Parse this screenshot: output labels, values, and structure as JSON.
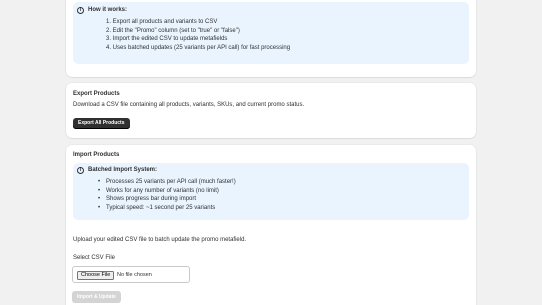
{
  "how_it_works": {
    "title": "How it works:",
    "steps": [
      "1. Export all products and variants to CSV",
      "2. Edit the \"Promo\" column (set to \"true\" or \"false\")",
      "3. Import the edited CSV to update metafields",
      "4. Uses batched updates (25 variants per API call) for fast processing"
    ]
  },
  "export": {
    "heading": "Export Products",
    "description": "Download a CSV file containing all products, variants, SKUs, and current promo status.",
    "button_label": "Export All Products"
  },
  "import": {
    "heading": "Import Products",
    "banner_title": "Batched Import System:",
    "features": [
      "Processes 25 variants per API call (much faster!)",
      "Works for any number of variants (no limit)",
      "Shows progress bar during import",
      "Typical speed: ~1 second per 25 variants"
    ],
    "upload_text": "Upload your edited CSV file to batch update the promo metafield.",
    "select_label": "Select CSV File",
    "choose_file_label": "Choose File",
    "file_status": "No file chosen",
    "submit_label": "Import & Update"
  },
  "info_icon": "info-icon",
  "colors": {
    "page_bg": "#f1f1f1",
    "banner_bg": "#eaf4ff",
    "primary_button": "#303030",
    "disabled_button": "#d4d4d4"
  }
}
